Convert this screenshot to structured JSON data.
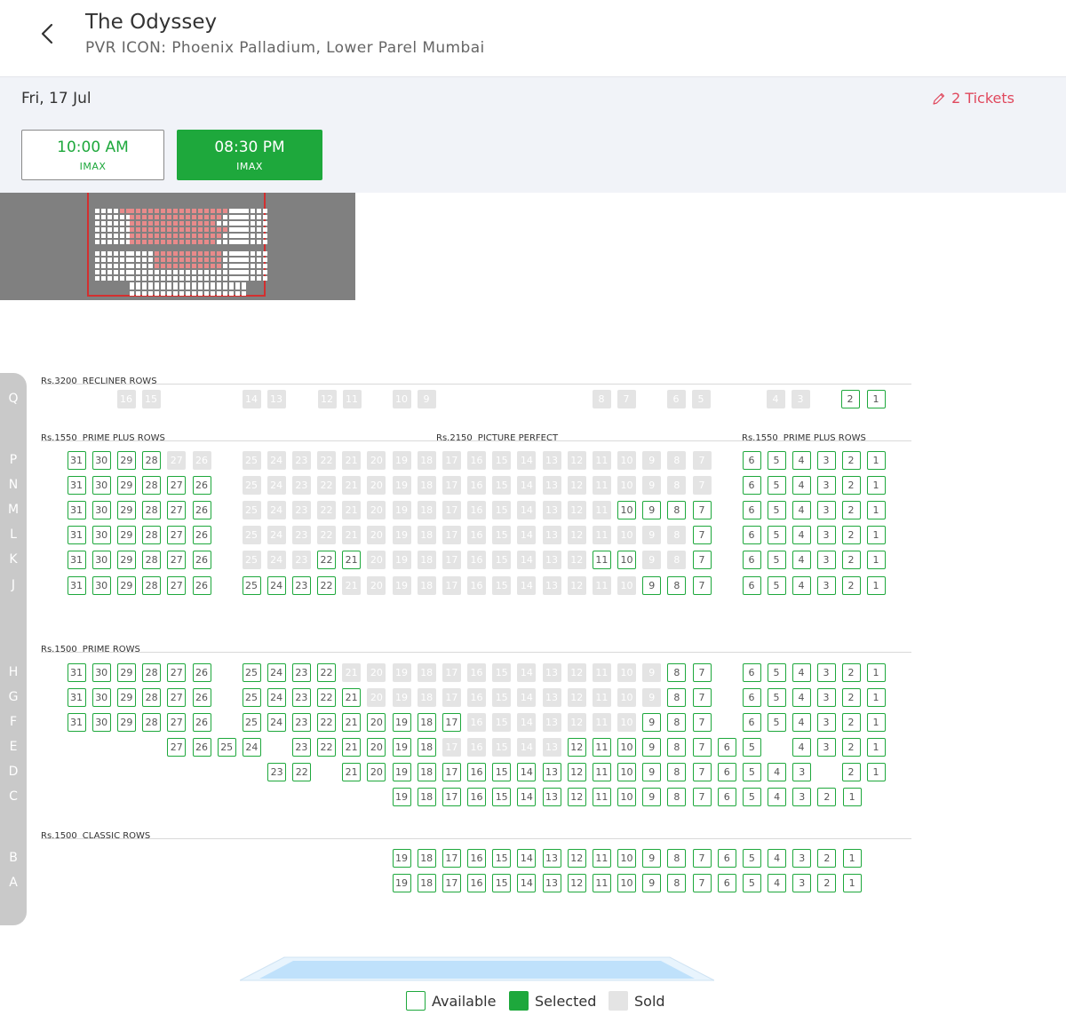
{
  "header": {
    "title": "The Odyssey",
    "subtitle": "PVR ICON: Phoenix Palladium, Lower Parel Mumbai"
  },
  "datebar": {
    "date": "Fri, 17 Jul",
    "tickets_label": "2 Tickets"
  },
  "showtimes": [
    {
      "time": "10:00 AM",
      "format": "IMAX",
      "selected": false
    },
    {
      "time": "08:30 PM",
      "format": "IMAX",
      "selected": true
    }
  ],
  "colors": {
    "accent": "#1ea83c",
    "sold": "#e4e4e4",
    "tickets": "#e0485d",
    "minimap_frame": "#d32f2f"
  },
  "sections": [
    {
      "price": "Rs.3200",
      "name": "RECLINER ROWS"
    },
    {
      "price": "Rs.1550",
      "name": "PRIME PLUS ROWS"
    },
    {
      "price": "Rs.2150",
      "name": "PICTURE PERFECT"
    },
    {
      "price": "Rs.1550",
      "name": "PRIME PLUS ROWS"
    },
    {
      "price": "Rs.1500",
      "name": "PRIME ROWS"
    },
    {
      "price": "Rs.1500",
      "name": "CLASSIC ROWS"
    }
  ],
  "rows": {
    "Q": {
      "left": [],
      "center": [
        "16",
        "15",
        "14",
        "13",
        "12",
        "11",
        "10",
        "9",
        "8",
        "7",
        "6",
        "5",
        "4",
        "3"
      ],
      "center_status": "sold",
      "right": [
        "2",
        "1"
      ]
    },
    "P": {
      "left": [
        "31",
        "30",
        "29",
        "28"
      ],
      "left_sold": [
        "27",
        "26"
      ],
      "center_sold": [
        "25",
        "24",
        "23",
        "22",
        "21",
        "20",
        "19",
        "18",
        "17",
        "16",
        "15",
        "14",
        "13",
        "12",
        "11",
        "10",
        "9",
        "8",
        "7"
      ],
      "right": [
        "6",
        "5",
        "4",
        "3",
        "2",
        "1"
      ]
    },
    "N": {
      "left": [
        "31",
        "30",
        "29",
        "28",
        "27",
        "26"
      ],
      "center_sold": [
        "25",
        "24",
        "23",
        "22",
        "21",
        "20",
        "19",
        "18",
        "17",
        "16",
        "15",
        "14",
        "13",
        "12",
        "11",
        "10",
        "9",
        "8",
        "7"
      ],
      "right": [
        "6",
        "5",
        "4",
        "3",
        "2",
        "1"
      ]
    },
    "M": {
      "left": [
        "31",
        "30",
        "29",
        "28",
        "27",
        "26"
      ],
      "center_sold": [
        "25",
        "24",
        "23",
        "22",
        "21",
        "20",
        "19",
        "18",
        "17",
        "16",
        "15",
        "14",
        "13",
        "12",
        "11"
      ],
      "center_avail": [
        "10",
        "9",
        "8",
        "7"
      ],
      "right": [
        "6",
        "5",
        "4",
        "3",
        "2",
        "1"
      ]
    },
    "L": {
      "left": [
        "31",
        "30",
        "29",
        "28",
        "27",
        "26"
      ],
      "center_sold": [
        "25",
        "24",
        "23",
        "22",
        "21",
        "20",
        "19",
        "18",
        "17",
        "16",
        "15",
        "14",
        "13",
        "12",
        "11",
        "10",
        "9",
        "8"
      ],
      "center_avail": [
        "7"
      ],
      "right": [
        "6",
        "5",
        "4",
        "3",
        "2",
        "1"
      ]
    },
    "K": {
      "left": [
        "31",
        "30",
        "29",
        "28",
        "27",
        "26"
      ],
      "center_sold_a": [
        "25",
        "24",
        "23"
      ],
      "center_avail_a": [
        "22",
        "21"
      ],
      "center_sold_b": [
        "20",
        "19",
        "18",
        "17",
        "16",
        "15",
        "14",
        "13",
        "12"
      ],
      "center_avail_b": [
        "11",
        "10"
      ],
      "center_sold_c": [
        "9",
        "8"
      ],
      "center_avail_c": [
        "7"
      ],
      "right": [
        "6",
        "5",
        "4",
        "3",
        "2",
        "1"
      ]
    },
    "J": {
      "left": [
        "31",
        "30",
        "29",
        "28",
        "27",
        "26"
      ],
      "center_avail_a": [
        "25",
        "24",
        "23",
        "22"
      ],
      "center_sold": [
        "21",
        "20",
        "19",
        "18",
        "17",
        "16",
        "15",
        "14",
        "13",
        "12",
        "11",
        "10"
      ],
      "center_avail_b": [
        "9",
        "8",
        "7"
      ],
      "right": [
        "6",
        "5",
        "4",
        "3",
        "2",
        "1"
      ]
    },
    "H": {
      "left": [
        "31",
        "30",
        "29",
        "28",
        "27",
        "26"
      ],
      "center_avail_a": [
        "25",
        "24",
        "23",
        "22"
      ],
      "center_sold": [
        "21",
        "20",
        "19",
        "18",
        "17",
        "16",
        "15",
        "14",
        "13",
        "12",
        "11",
        "10",
        "9"
      ],
      "center_avail_b": [
        "8",
        "7"
      ],
      "right": [
        "6",
        "5",
        "4",
        "3",
        "2",
        "1"
      ]
    },
    "G": {
      "left": [
        "31",
        "30",
        "29",
        "28",
        "27",
        "26"
      ],
      "center_avail_a": [
        "25",
        "24",
        "23",
        "22",
        "21"
      ],
      "center_sold": [
        "20",
        "19",
        "18",
        "17",
        "16",
        "15",
        "14",
        "13",
        "12",
        "11",
        "10",
        "9"
      ],
      "center_avail_b": [
        "8",
        "7"
      ],
      "right": [
        "6",
        "5",
        "4",
        "3",
        "2",
        "1"
      ]
    },
    "F": {
      "left": [
        "31",
        "30",
        "29",
        "28",
        "27",
        "26"
      ],
      "center_avail_a": [
        "25",
        "24",
        "23",
        "22",
        "21",
        "20",
        "19",
        "18",
        "17"
      ],
      "center_sold": [
        "16",
        "15",
        "14",
        "13",
        "12",
        "11",
        "10"
      ],
      "center_avail_b": [
        "9",
        "8",
        "7"
      ],
      "right": [
        "6",
        "5",
        "4",
        "3",
        "2",
        "1"
      ]
    },
    "E": {
      "left": [
        "27",
        "26",
        "25",
        "24"
      ],
      "center_avail_a": [
        "23",
        "22",
        "21",
        "20",
        "19",
        "18"
      ],
      "center_sold": [
        "17",
        "16",
        "15",
        "14",
        "13"
      ],
      "center_avail_b": [
        "12",
        "11",
        "10",
        "9",
        "8",
        "7",
        "6",
        "5"
      ],
      "right": [
        "4",
        "3",
        "2",
        "1"
      ]
    },
    "D": {
      "left": [
        "23",
        "22"
      ],
      "center_avail_a": [
        "21",
        "20",
        "19",
        "18",
        "17",
        "16",
        "15",
        "14",
        "13",
        "12",
        "11",
        "10",
        "9",
        "8",
        "7",
        "6",
        "5",
        "4",
        "3"
      ],
      "right": [
        "2",
        "1"
      ]
    },
    "C": {
      "center_avail_a": [
        "19",
        "18",
        "17",
        "16",
        "15",
        "14",
        "13",
        "12",
        "11",
        "10",
        "9",
        "8",
        "7",
        "6",
        "5",
        "4",
        "3",
        "2",
        "1"
      ]
    },
    "B": {
      "center_avail_a": [
        "19",
        "18",
        "17",
        "16",
        "15",
        "14",
        "13",
        "12",
        "11",
        "10",
        "9",
        "8",
        "7",
        "6",
        "5",
        "4",
        "3",
        "2",
        "1"
      ]
    },
    "A": {
      "center_avail_a": [
        "19",
        "18",
        "17",
        "16",
        "15",
        "14",
        "13",
        "12",
        "11",
        "10",
        "9",
        "8",
        "7",
        "6",
        "5",
        "4",
        "3",
        "2",
        "1"
      ]
    }
  },
  "legend": {
    "available": "Available",
    "selected": "Selected",
    "sold": "Sold"
  },
  "icons": {
    "back": "back-arrow-icon",
    "edit": "pencil-icon"
  }
}
